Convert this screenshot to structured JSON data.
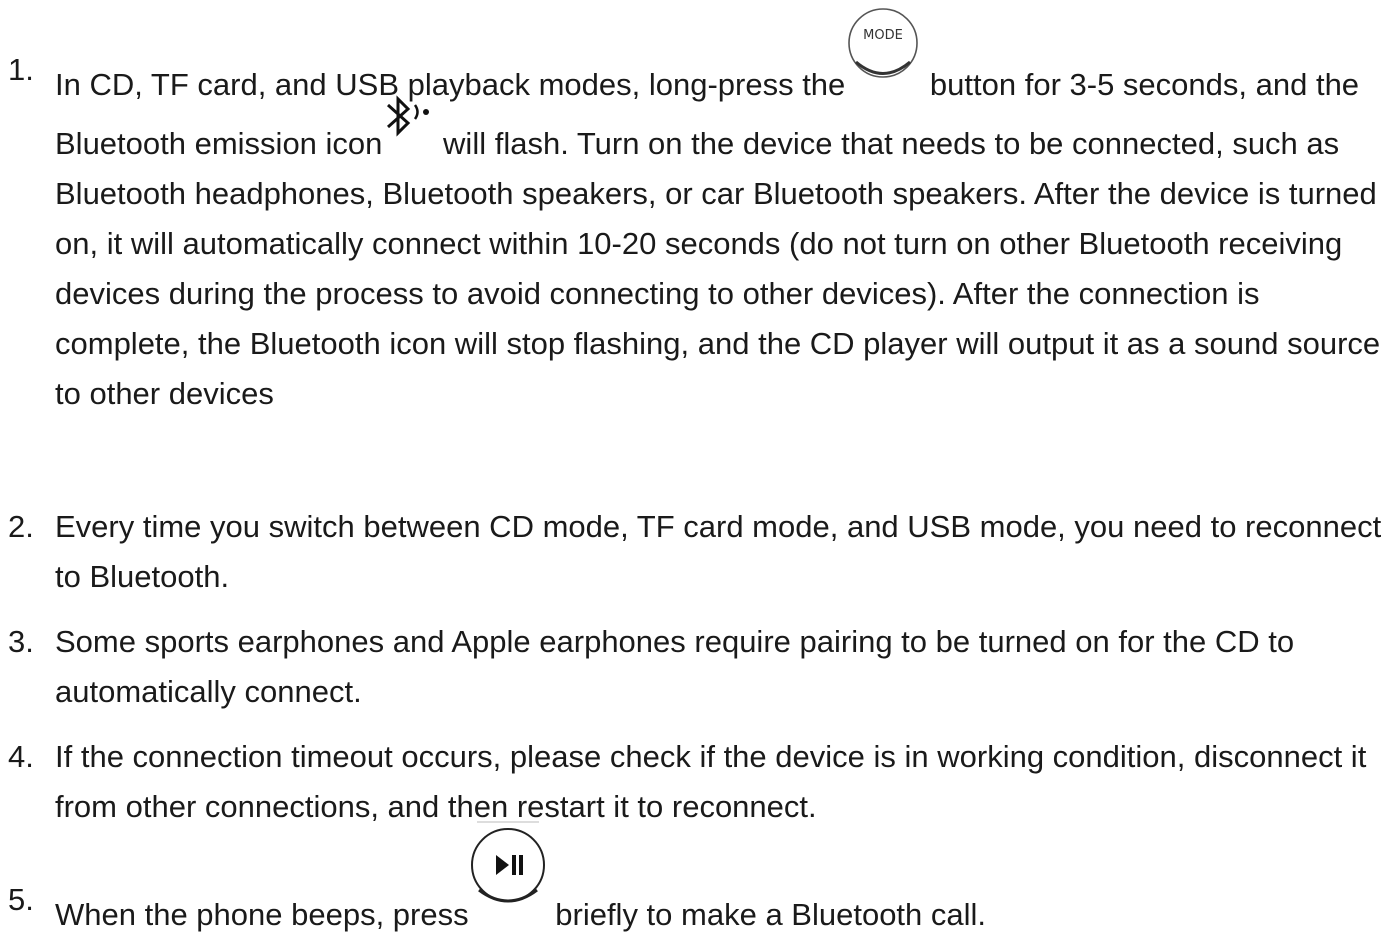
{
  "instructions": {
    "items": [
      {
        "number": "1.",
        "text_before": "In CD, TF card, and USB playback modes, long-press the",
        "text_middle": "button for 3-5 seconds, and the Bluetooth emission icon",
        "text_after": "will flash. Turn on the device that needs to be connected, such as Bluetooth headphones, Bluetooth speakers, or car Bluetooth speakers. After the device is turned on, it will automatically connect within 10-20 seconds (do not turn on other Bluetooth receiving devices during the process to avoid connecting to other devices). After the connection is complete, the Bluetooth icon will stop flashing, and the CD player will output it as a sound source to other devices"
      },
      {
        "number": "2.",
        "text": "Every time you switch between CD mode, TF card mode, and USB mode, you need to reconnect to Bluetooth."
      },
      {
        "number": "3.",
        "text": "Some sports earphones and Apple earphones require pairing to be turned on for the CD to automatically connect."
      },
      {
        "number": "4.",
        "text": "If the connection timeout occurs, please check if the device is in working condition, disconnect it from other connections, and then restart it to reconnect."
      },
      {
        "number": "5.",
        "text_before": "When the phone beeps, press",
        "text_after": "briefly to make a Bluetooth call."
      }
    ]
  },
  "icons": {
    "mode_button": {
      "name": "mode-button-icon",
      "label": "MODE"
    },
    "bluetooth": {
      "name": "bluetooth-emission-icon"
    },
    "play_pause": {
      "name": "play-pause-button-icon"
    }
  }
}
